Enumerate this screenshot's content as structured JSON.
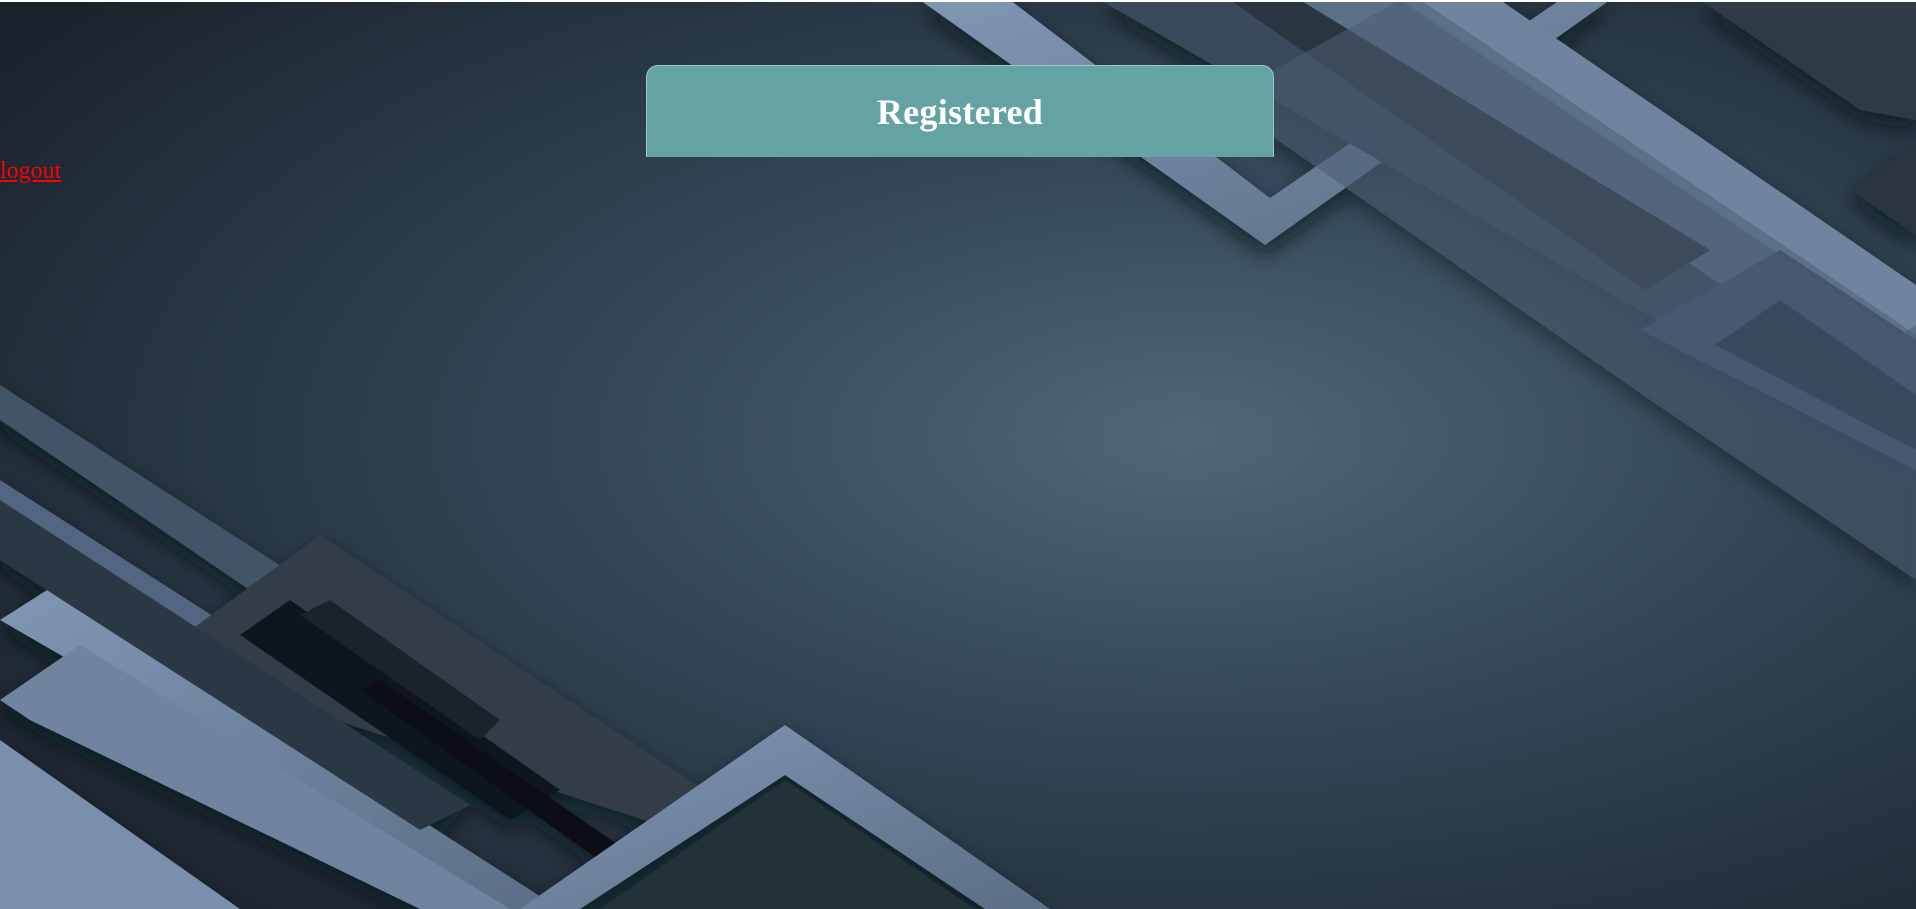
{
  "header": {
    "title": "Registered"
  },
  "nav": {
    "logout_label": "logout"
  },
  "colors": {
    "background_dark": "#1c2631",
    "background_glow": "#52667a",
    "stripe_light": "#7489a6",
    "stripe_shadow": "#2b3744",
    "panel_header": "#64a2a4",
    "logout_link": "#ff0000"
  }
}
